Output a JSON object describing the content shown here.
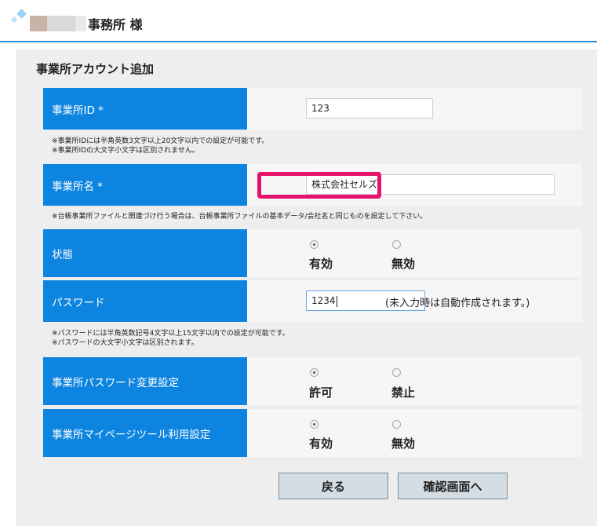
{
  "header": {
    "office_name": "事務所 様"
  },
  "page": {
    "section_title": "事業所アカウント追加"
  },
  "form": {
    "office_id": {
      "label": "事業所ID *",
      "value": "123",
      "hints": [
        "※事業所IDには半角英数3文字以上20文字以内での設定が可能です。",
        "※事業所IDの大文字小文字は区別されません。"
      ]
    },
    "office_name": {
      "label": "事業所名 *",
      "value": "株式会社セルズ",
      "hints": [
        "※台帳事業所ファイルと関連づけ行う場合は、台帳事業所ファイルの基本データ/会社名と同じものを設定して下さい。"
      ]
    },
    "status": {
      "label": "状態",
      "options": [
        {
          "label": "有効",
          "checked": true
        },
        {
          "label": "無効",
          "checked": false
        }
      ]
    },
    "password": {
      "label": "パスワード",
      "value": "1234",
      "note": "(未入力時は自動作成されます。)",
      "hints": [
        "※パスワードには半角英数記号4文字以上15文字以内での設定が可能です。",
        "※パスワードの大文字小文字は区別されます。"
      ]
    },
    "password_change": {
      "label": "事業所パスワード変更設定",
      "options": [
        {
          "label": "許可",
          "checked": true
        },
        {
          "label": "禁止",
          "checked": false
        }
      ]
    },
    "mypage_tool": {
      "label": "事業所マイページツール利用設定",
      "options": [
        {
          "label": "有効",
          "checked": true
        },
        {
          "label": "無効",
          "checked": false
        }
      ]
    }
  },
  "buttons": {
    "back": "戻る",
    "confirm": "確認画面へ"
  },
  "colors": {
    "label_bg": "#0d84df",
    "highlight": "#e6126b",
    "header_line": "#2b8fe0",
    "button_bg": "#d4dde4"
  }
}
